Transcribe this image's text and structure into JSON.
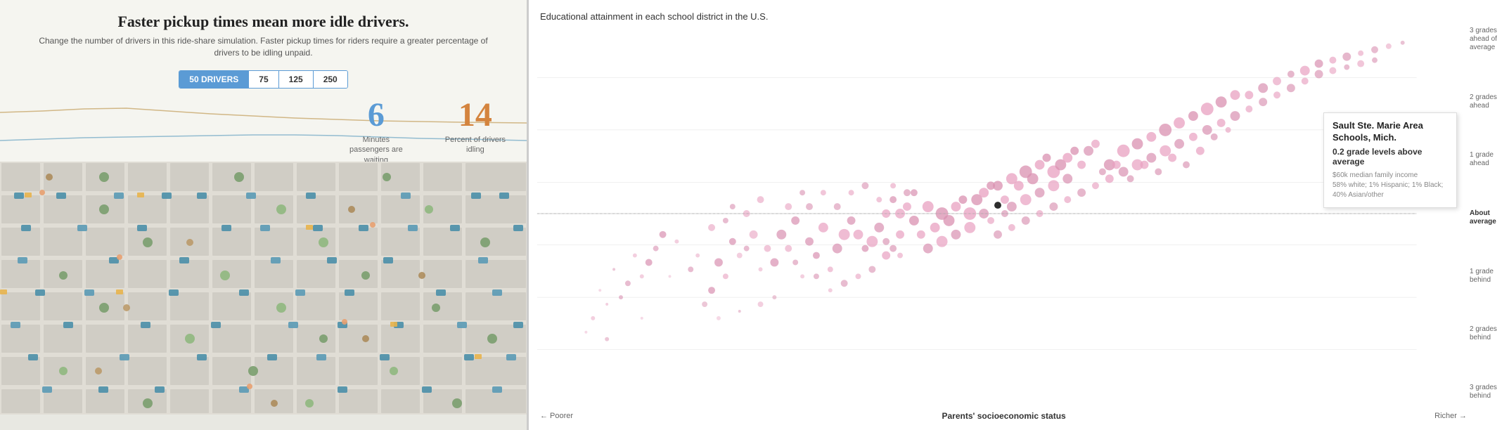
{
  "left": {
    "title": "Faster pickup times mean more idle drivers.",
    "subtitle": "Change the number of drivers in this ride-share simulation. Faster pickup times for riders require a greater percentage of drivers to be idling unpaid.",
    "buttons": [
      {
        "label": "50 DRIVERS",
        "active": true
      },
      {
        "label": "75",
        "active": false
      },
      {
        "label": "125",
        "active": false
      },
      {
        "label": "250",
        "active": false
      }
    ],
    "stat1": {
      "number": "6",
      "label": "Minutes\npassengers are\nwaiting"
    },
    "stat2": {
      "number": "14",
      "label": "Percent of drivers\nidling"
    }
  },
  "right": {
    "title": "Educational attainment in each school district in the U.S.",
    "y_labels": [
      {
        "text": "3 grades\nahead of\naverage",
        "position": "top"
      },
      {
        "text": "2 grades\nahead",
        "position": ""
      },
      {
        "text": "1 grade\nahead",
        "position": ""
      },
      {
        "text": "About\naverage",
        "position": "middle",
        "highlight": true
      },
      {
        "text": "1 grade\nbehind",
        "position": ""
      },
      {
        "text": "2 grades\nbehind",
        "position": ""
      },
      {
        "text": "3 grades\nbehind",
        "position": "bottom"
      }
    ],
    "x_label_left": "← Poorer",
    "x_label_center": "Parents' socioeconomic status",
    "x_label_right": "Richer →",
    "tooltip": {
      "title": "Sault Ste. Marie Area Schools, Mich.",
      "grade_text": "0.2",
      "grade_suffix": "grade levels above average",
      "detail_line1": "$60k median family income",
      "detail_line2": "58% white; 1% Hispanic; 1% Black;",
      "detail_line3": "40% Asian/other"
    }
  }
}
